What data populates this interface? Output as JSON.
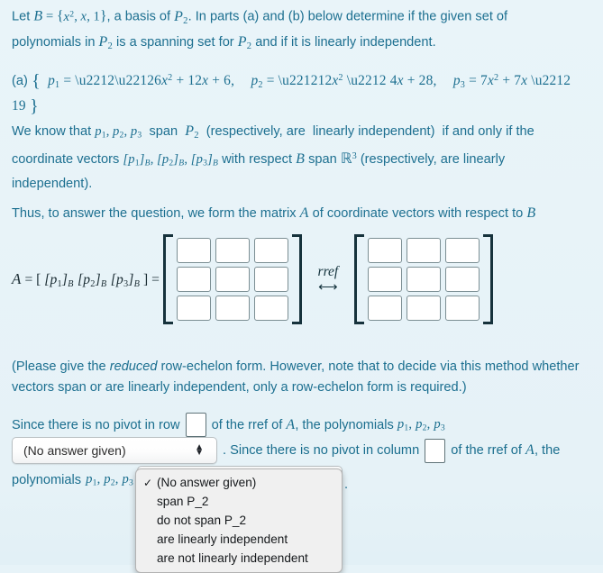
{
  "colors": {
    "background": "#e7f3f8",
    "text": "#1c6f90",
    "math": "#14333d",
    "input_border": "#7b8e93",
    "select_border": "#b9bfc2"
  },
  "intro": {
    "line1_pre": "Let ",
    "basis_symbol": "B",
    "equals": " = ",
    "basis_set": "{ x², x, 1 }",
    "line1_mid": ", a basis of ",
    "space_symbol": "P₂",
    "line1_post": ". In parts (a) and (b) below determine if the given set of",
    "line2": "polynomials in P₂ is a spanning set for P₂ and if it is linearly independent.",
    "full_text": "Let B = {x², x, 1}, a basis of P₂. In parts (a) and (b) below determine if the given set of polynomials in P₂ is a spanning set for P₂ and if it is linearly independent."
  },
  "part_a": {
    "label": "(a)",
    "p1": "p₁ = −6x² + 12x + 6,",
    "p2": "p₂ = −12x² − 4x + 28,",
    "p3": "p₃ = 7x² + 7x − 19",
    "full_text": "(a) { p₁ = −6x² + 12x + 6,   p₂ = −12x² − 4x + 28,   p₃ = 7x² + 7x − 19 }"
  },
  "explanation": {
    "text": "We know that p₁, p₂, p₃ span P₂ (respectively, are linearly independent) if and only if the coordinate vectors [p₁]ʙ, [p₂]ʙ, [p₃]ʙ with respect B span ℝ³ (respectively, are linearly independent)."
  },
  "thus": {
    "text": "Thus, to answer the question, we form the matrix A of coordinate vectors with respect to B"
  },
  "matrix": {
    "lhs": "A = [ [p₁]ʙ [p₂]ʙ [p₃]ʙ ] =",
    "rref_label": "rref",
    "rref_arrow": "⟷",
    "rows": 3,
    "cols": 3,
    "left_matrix_values": [
      [
        "",
        "",
        ""
      ],
      [
        "",
        "",
        ""
      ],
      [
        "",
        "",
        ""
      ]
    ],
    "right_matrix_values": [
      [
        "",
        "",
        ""
      ],
      [
        "",
        "",
        ""
      ],
      [
        "",
        "",
        ""
      ]
    ]
  },
  "note": {
    "pre": "(Please give the ",
    "emph": "reduced",
    "post": " row-echelon form. However, note that to decide via this method whether vectors span or are linearly independent, only a row-echelon form is required.)"
  },
  "answer": {
    "line1_pre": "Since there is no pivot in row",
    "row_box_value": "",
    "line1_mid": "of the rref of A, the polynomials",
    "line1_polys": "p₁, p₂, p₃",
    "select1_value": "(No answer given)",
    "line2_pre": ". Since there is no pivot in column",
    "column_box_value": "",
    "line2_post": "of the rref of A, the",
    "line3_pre": "polynomials",
    "line3_polys": "p₁, p₂, p₃",
    "select2_value": "(No answer given)",
    "period": "."
  },
  "dropdown": {
    "open": true,
    "selected_index": 0,
    "check_glyph": "✓",
    "items": [
      {
        "label": "(No answer given)",
        "checked": true
      },
      {
        "label": "span P_2",
        "checked": false
      },
      {
        "label": "do not span P_2",
        "checked": false
      },
      {
        "label": "are linearly independent",
        "checked": false
      },
      {
        "label": "are not linearly independent",
        "checked": false
      }
    ]
  },
  "icons": {
    "stepper": "up-down-chevron-icon",
    "checkmark": "checkmark-icon"
  }
}
